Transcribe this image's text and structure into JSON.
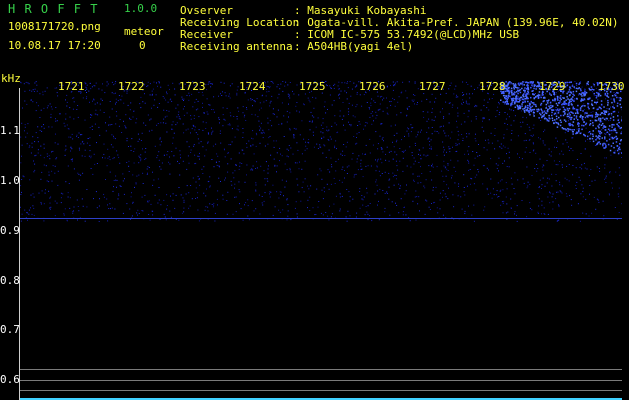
{
  "header": {
    "app_name": "H R O F F T",
    "version": "1.0.0",
    "filename": "1008171720.png",
    "datetime": "10.08.17 17:20",
    "meteor_label": "meteor",
    "meteor_count": "0",
    "fields": [
      {
        "label": "Ovserver",
        "value": ": Masayuki Kobayashi"
      },
      {
        "label": "Receiving Location",
        "value": ": Ogata-vill. Akita-Pref. JAPAN (139.96E, 40.02N)"
      },
      {
        "label": "Receiver",
        "value": ": ICOM IC-575 53.7492(@LCD)MHz USB"
      },
      {
        "label": "Receiving antenna",
        "value": ": A504HB(yagi 4el)"
      }
    ]
  },
  "axis": {
    "y_unit": "kHz",
    "y_ticks": [
      "1.1",
      "1.0",
      "0.9",
      "0.8",
      "0.7",
      "0.6"
    ],
    "x_ticks": [
      "1721",
      "1722",
      "1723",
      "1724",
      "1725",
      "1726",
      "1727",
      "1728",
      "1729",
      "1730"
    ]
  },
  "colors": {
    "background": "#000000",
    "signal": "#2a3cff",
    "label_yellow": "#ffff3c",
    "title_green": "#36d04a"
  }
}
